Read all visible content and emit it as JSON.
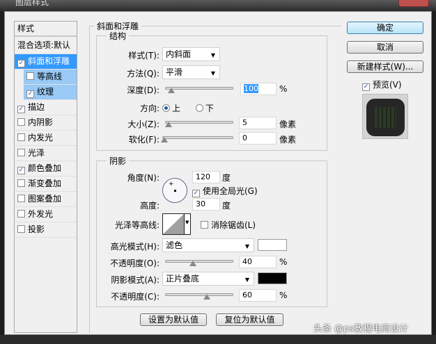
{
  "window": {
    "title": "图层样式"
  },
  "styles_list": {
    "header": "样式",
    "blend_options": "混合选项:默认",
    "items": [
      {
        "label": "斜面和浮雕",
        "checked": true,
        "selected": true,
        "indent": false
      },
      {
        "label": "等高线",
        "checked": false,
        "selected": false,
        "indent": true
      },
      {
        "label": "纹理",
        "checked": true,
        "selected": false,
        "indent": true
      },
      {
        "label": "描边",
        "checked": true
      },
      {
        "label": "内阴影",
        "checked": false
      },
      {
        "label": "内发光",
        "checked": false
      },
      {
        "label": "光泽",
        "checked": false
      },
      {
        "label": "颜色叠加",
        "checked": true
      },
      {
        "label": "渐变叠加",
        "checked": false
      },
      {
        "label": "图案叠加",
        "checked": false
      },
      {
        "label": "外发光",
        "checked": false
      },
      {
        "label": "投影",
        "checked": false
      }
    ]
  },
  "bevel": {
    "title": "斜面和浮雕",
    "structure": {
      "title": "结构",
      "style_label": "样式(T):",
      "style_value": "内斜面",
      "technique_label": "方法(Q):",
      "technique_value": "平滑",
      "depth_label": "深度(D):",
      "depth_value": "100",
      "depth_unit": "%",
      "direction_label": "方向:",
      "dir_up": "上",
      "dir_down": "下",
      "size_label": "大小(Z):",
      "size_value": "5",
      "size_unit": "像素",
      "soften_label": "软化(F):",
      "soften_value": "0",
      "soften_unit": "像素"
    },
    "shading": {
      "title": "阴影",
      "angle_label": "角度(N):",
      "angle_value": "120",
      "angle_unit": "度",
      "global_light": "使用全局光(G)",
      "altitude_label": "高度:",
      "altitude_value": "30",
      "altitude_unit": "度",
      "gloss_label": "光泽等高线:",
      "antialias": "消除锯齿(L)",
      "highlight_label": "高光模式(H):",
      "highlight_value": "滤色",
      "highlight_color": "#ffffff",
      "opacity1_label": "不透明度(O):",
      "opacity1_value": "40",
      "pct": "%",
      "shadow_label": "阴影模式(A):",
      "shadow_value": "正片叠底",
      "shadow_color": "#000000",
      "opacity2_label": "不透明度(C):",
      "opacity2_value": "60"
    },
    "make_default": "设置为默认值",
    "reset_default": "复位为默认值"
  },
  "right": {
    "ok": "确定",
    "cancel": "取消",
    "new_style": "新建样式(W)...",
    "preview": "预览(V)"
  },
  "watermark": "头条 @ps教程电商设计"
}
